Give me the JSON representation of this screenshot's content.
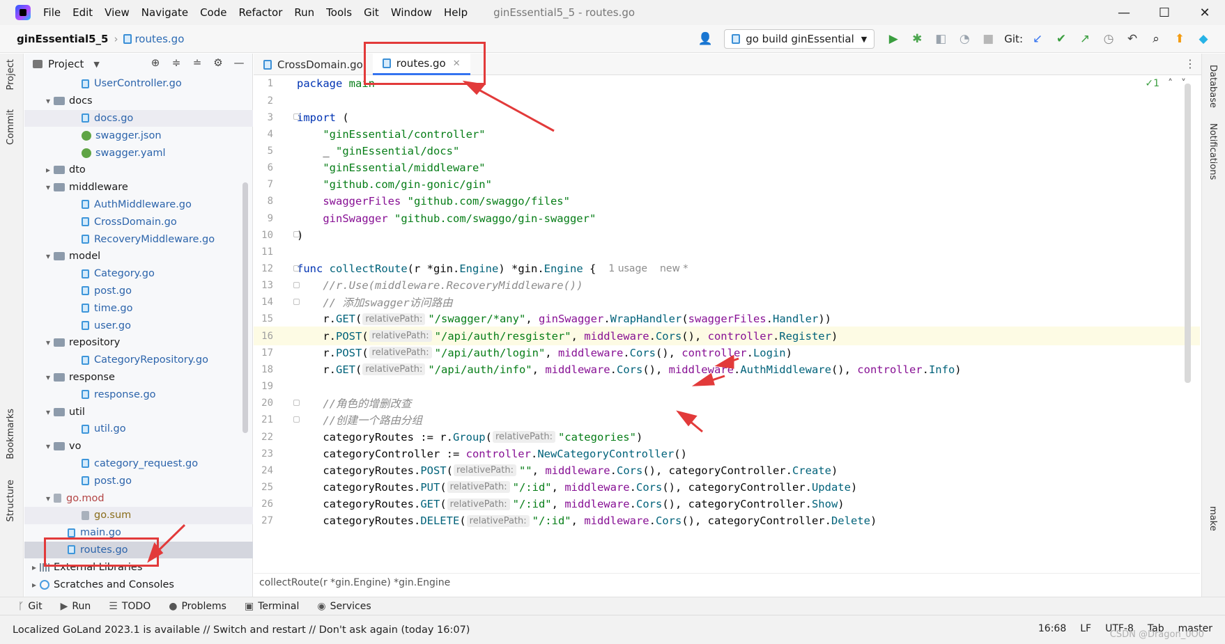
{
  "menu": [
    "File",
    "Edit",
    "View",
    "Navigate",
    "Code",
    "Refactor",
    "Run",
    "Tools",
    "Git",
    "Window",
    "Help"
  ],
  "window_title": "ginEssential5_5 - routes.go",
  "window_controls": [
    "—",
    "☐",
    "✕"
  ],
  "nav": {
    "project_name": "ginEssential5_5",
    "file_name": "routes.go",
    "run_config": "go build ginEssential",
    "git_label": "Git:"
  },
  "left_strip": {
    "project": "Project",
    "commit": "Commit",
    "bookmarks": "Bookmarks",
    "structure": "Structure"
  },
  "right_strip": {
    "database": "Database",
    "notifications": "Notifications",
    "make": "make"
  },
  "project_panel": {
    "title": "Project"
  },
  "tree": [
    {
      "label": "UserController.go",
      "indent": 3,
      "icon": "go",
      "arrow": "",
      "color": "blue"
    },
    {
      "label": "docs",
      "indent": 1,
      "icon": "folder",
      "arrow": "▾",
      "color": ""
    },
    {
      "label": "docs.go",
      "indent": 3,
      "icon": "go",
      "arrow": "",
      "color": "blue",
      "hl": true
    },
    {
      "label": "swagger.json",
      "indent": 3,
      "icon": "json",
      "arrow": "",
      "color": "blue"
    },
    {
      "label": "swagger.yaml",
      "indent": 3,
      "icon": "json",
      "arrow": "",
      "color": "blue"
    },
    {
      "label": "dto",
      "indent": 1,
      "icon": "folder",
      "arrow": "▸",
      "color": ""
    },
    {
      "label": "middleware",
      "indent": 1,
      "icon": "folder",
      "arrow": "▾",
      "color": ""
    },
    {
      "label": "AuthMiddleware.go",
      "indent": 3,
      "icon": "go",
      "arrow": "",
      "color": "blue"
    },
    {
      "label": "CrossDomain.go",
      "indent": 3,
      "icon": "go",
      "arrow": "",
      "color": "blue"
    },
    {
      "label": "RecoveryMiddleware.go",
      "indent": 3,
      "icon": "go",
      "arrow": "",
      "color": "blue"
    },
    {
      "label": "model",
      "indent": 1,
      "icon": "folder",
      "arrow": "▾",
      "color": ""
    },
    {
      "label": "Category.go",
      "indent": 3,
      "icon": "go",
      "arrow": "",
      "color": "blue"
    },
    {
      "label": "post.go",
      "indent": 3,
      "icon": "go",
      "arrow": "",
      "color": "blue"
    },
    {
      "label": "time.go",
      "indent": 3,
      "icon": "go",
      "arrow": "",
      "color": "blue"
    },
    {
      "label": "user.go",
      "indent": 3,
      "icon": "go",
      "arrow": "",
      "color": "blue"
    },
    {
      "label": "repository",
      "indent": 1,
      "icon": "folder",
      "arrow": "▾",
      "color": ""
    },
    {
      "label": "CategoryRepository.go",
      "indent": 3,
      "icon": "go",
      "arrow": "",
      "color": "blue"
    },
    {
      "label": "response",
      "indent": 1,
      "icon": "folder",
      "arrow": "▾",
      "color": ""
    },
    {
      "label": "response.go",
      "indent": 3,
      "icon": "go",
      "arrow": "",
      "color": "blue"
    },
    {
      "label": "util",
      "indent": 1,
      "icon": "folder",
      "arrow": "▾",
      "color": ""
    },
    {
      "label": "util.go",
      "indent": 3,
      "icon": "go",
      "arrow": "",
      "color": "blue"
    },
    {
      "label": "vo",
      "indent": 1,
      "icon": "folder",
      "arrow": "▾",
      "color": ""
    },
    {
      "label": "category_request.go",
      "indent": 3,
      "icon": "go",
      "arrow": "",
      "color": "blue"
    },
    {
      "label": "post.go",
      "indent": 3,
      "icon": "go",
      "arrow": "",
      "color": "blue"
    },
    {
      "label": "go.mod",
      "indent": 1,
      "icon": "mod",
      "arrow": "▾",
      "color": "red"
    },
    {
      "label": "go.sum",
      "indent": 3,
      "icon": "mod",
      "arrow": "",
      "color": "gold",
      "hl": true
    },
    {
      "label": "main.go",
      "indent": 2,
      "icon": "go",
      "arrow": "",
      "color": "blue"
    },
    {
      "label": "routes.go",
      "indent": 2,
      "icon": "go",
      "arrow": "",
      "color": "blue",
      "sel": true
    },
    {
      "label": "External Libraries",
      "indent": 0,
      "icon": "lib",
      "arrow": "▸",
      "color": ""
    },
    {
      "label": "Scratches and Consoles",
      "indent": 0,
      "icon": "scr",
      "arrow": "▸",
      "color": ""
    }
  ],
  "tabs": [
    {
      "label": "CrossDomain.go",
      "active": false
    },
    {
      "label": "routes.go",
      "active": true
    }
  ],
  "inspection": {
    "count": "✓1",
    "up": "˄",
    "down": "˅"
  },
  "code": [
    {
      "n": "1",
      "t": [
        [
          "kw",
          "package"
        ],
        [
          "code",
          " "
        ],
        [
          "str",
          "main"
        ]
      ]
    },
    {
      "n": "2",
      "t": []
    },
    {
      "n": "3",
      "t": [
        [
          "kw",
          "import"
        ],
        [
          "code",
          " ("
        ]
      ]
    },
    {
      "n": "4",
      "t": [
        [
          "code",
          "    "
        ],
        [
          "str",
          "\"ginEssential/controller\""
        ]
      ]
    },
    {
      "n": "5",
      "t": [
        [
          "code",
          "    _ "
        ],
        [
          "str",
          "\"ginEssential/docs\""
        ]
      ]
    },
    {
      "n": "6",
      "t": [
        [
          "code",
          "    "
        ],
        [
          "str",
          "\"ginEssential/middleware\""
        ]
      ]
    },
    {
      "n": "7",
      "t": [
        [
          "code",
          "    "
        ],
        [
          "str",
          "\"github.com/gin-gonic/gin\""
        ]
      ]
    },
    {
      "n": "8",
      "t": [
        [
          "code",
          "    "
        ],
        [
          "gold",
          "swaggerFiles"
        ],
        [
          "code",
          " "
        ],
        [
          "str",
          "\"github.com/swaggo/files\""
        ]
      ]
    },
    {
      "n": "9",
      "t": [
        [
          "code",
          "    "
        ],
        [
          "gold",
          "ginSwagger"
        ],
        [
          "code",
          " "
        ],
        [
          "str",
          "\"github.com/swaggo/gin-swagger\""
        ]
      ]
    },
    {
      "n": "10",
      "t": [
        [
          "code",
          ")"
        ]
      ]
    },
    {
      "n": "11",
      "t": []
    },
    {
      "n": "12",
      "t": [
        [
          "kw",
          "func"
        ],
        [
          "code",
          " "
        ],
        [
          "fn",
          "collectRoute"
        ],
        [
          "code",
          "(r *"
        ],
        [
          "code",
          "gin"
        ],
        [
          "code",
          "."
        ],
        [
          "fn",
          "Engine"
        ],
        [
          "code",
          ") *"
        ],
        [
          "code",
          "gin"
        ],
        [
          "code",
          "."
        ],
        [
          "fn",
          "Engine"
        ],
        [
          "code",
          " {"
        ],
        [
          "hint",
          "1 usage"
        ],
        [
          "hint2",
          "new *"
        ]
      ]
    },
    {
      "n": "13",
      "t": [
        [
          "code",
          "    "
        ],
        [
          "cm",
          "//r.Use(middleware.RecoveryMiddleware())"
        ]
      ]
    },
    {
      "n": "14",
      "t": [
        [
          "code",
          "    "
        ],
        [
          "cm",
          "// 添加swagger访问路由"
        ]
      ]
    },
    {
      "n": "15",
      "t": [
        [
          "code",
          "    r."
        ],
        [
          "fn",
          "GET"
        ],
        [
          "code",
          "("
        ],
        [
          "inlay",
          "relativePath:"
        ],
        [
          "str",
          "\"/swagger/*any\""
        ],
        [
          "code",
          ", "
        ],
        [
          "gold",
          "ginSwagger"
        ],
        [
          "code",
          "."
        ],
        [
          "fn",
          "WrapHandler"
        ],
        [
          "code",
          "("
        ],
        [
          "gold",
          "swaggerFiles"
        ],
        [
          "code",
          "."
        ],
        [
          "fn",
          "Handler"
        ],
        [
          "code",
          "))"
        ]
      ]
    },
    {
      "n": "16",
      "t": [
        [
          "code",
          "    r."
        ],
        [
          "fn",
          "POST"
        ],
        [
          "code",
          "("
        ],
        [
          "inlay",
          "relativePath:"
        ],
        [
          "str",
          "\"/api/auth/resgister\""
        ],
        [
          "code",
          ", "
        ],
        [
          "gold",
          "middleware"
        ],
        [
          "code",
          "."
        ],
        [
          "fn",
          "Cors"
        ],
        [
          "code",
          "(), "
        ],
        [
          "gold",
          "controller"
        ],
        [
          "code",
          "."
        ],
        [
          "fn",
          "Register"
        ],
        [
          "code",
          ")"
        ]
      ],
      "cur": true
    },
    {
      "n": "17",
      "t": [
        [
          "code",
          "    r."
        ],
        [
          "fn",
          "POST"
        ],
        [
          "code",
          "("
        ],
        [
          "inlay",
          "relativePath:"
        ],
        [
          "str",
          "\"/api/auth/login\""
        ],
        [
          "code",
          ", "
        ],
        [
          "gold",
          "middleware"
        ],
        [
          "code",
          "."
        ],
        [
          "fn",
          "Cors"
        ],
        [
          "code",
          "(), "
        ],
        [
          "gold",
          "controller"
        ],
        [
          "code",
          "."
        ],
        [
          "fn",
          "Login"
        ],
        [
          "code",
          ")"
        ]
      ]
    },
    {
      "n": "18",
      "t": [
        [
          "code",
          "    r."
        ],
        [
          "fn",
          "GET"
        ],
        [
          "code",
          "("
        ],
        [
          "inlay",
          "relativePath:"
        ],
        [
          "str",
          "\"/api/auth/info\""
        ],
        [
          "code",
          ", "
        ],
        [
          "gold",
          "middleware"
        ],
        [
          "code",
          "."
        ],
        [
          "fn",
          "Cors"
        ],
        [
          "code",
          "(), "
        ],
        [
          "gold",
          "middleware"
        ],
        [
          "code",
          "."
        ],
        [
          "fn",
          "AuthMiddleware"
        ],
        [
          "code",
          "(), "
        ],
        [
          "gold",
          "controller"
        ],
        [
          "code",
          "."
        ],
        [
          "fn",
          "Info"
        ],
        [
          "code",
          ")"
        ]
      ]
    },
    {
      "n": "19",
      "t": []
    },
    {
      "n": "20",
      "t": [
        [
          "code",
          "    "
        ],
        [
          "cm",
          "//角色的增删改查"
        ]
      ]
    },
    {
      "n": "21",
      "t": [
        [
          "code",
          "    "
        ],
        [
          "cm",
          "//创建一个路由分组"
        ]
      ]
    },
    {
      "n": "22",
      "t": [
        [
          "code",
          "    categoryRoutes := r."
        ],
        [
          "fn",
          "Group"
        ],
        [
          "code",
          "("
        ],
        [
          "inlay",
          "relativePath:"
        ],
        [
          "str",
          "\"categories\""
        ],
        [
          "code",
          ")"
        ]
      ]
    },
    {
      "n": "23",
      "t": [
        [
          "code",
          "    categoryController := "
        ],
        [
          "gold",
          "controller"
        ],
        [
          "code",
          "."
        ],
        [
          "fn",
          "NewCategoryController"
        ],
        [
          "code",
          "()"
        ]
      ]
    },
    {
      "n": "24",
      "t": [
        [
          "code",
          "    categoryRoutes."
        ],
        [
          "fn",
          "POST"
        ],
        [
          "code",
          "("
        ],
        [
          "inlay",
          "relativePath:"
        ],
        [
          "str",
          "\"\""
        ],
        [
          "code",
          ", "
        ],
        [
          "gold",
          "middleware"
        ],
        [
          "code",
          "."
        ],
        [
          "fn",
          "Cors"
        ],
        [
          "code",
          "(), categoryController."
        ],
        [
          "fn",
          "Create"
        ],
        [
          "code",
          ")"
        ]
      ]
    },
    {
      "n": "25",
      "t": [
        [
          "code",
          "    categoryRoutes."
        ],
        [
          "fn",
          "PUT"
        ],
        [
          "code",
          "("
        ],
        [
          "inlay",
          "relativePath:"
        ],
        [
          "str",
          "\"/:id\""
        ],
        [
          "code",
          ", "
        ],
        [
          "gold",
          "middleware"
        ],
        [
          "code",
          "."
        ],
        [
          "fn",
          "Cors"
        ],
        [
          "code",
          "(), categoryController."
        ],
        [
          "fn",
          "Update"
        ],
        [
          "code",
          ")"
        ]
      ]
    },
    {
      "n": "26",
      "t": [
        [
          "code",
          "    categoryRoutes."
        ],
        [
          "fn",
          "GET"
        ],
        [
          "code",
          "("
        ],
        [
          "inlay",
          "relativePath:"
        ],
        [
          "str",
          "\"/:id\""
        ],
        [
          "code",
          ", "
        ],
        [
          "gold",
          "middleware"
        ],
        [
          "code",
          "."
        ],
        [
          "fn",
          "Cors"
        ],
        [
          "code",
          "(), categoryController."
        ],
        [
          "fn",
          "Show"
        ],
        [
          "code",
          ")"
        ]
      ]
    },
    {
      "n": "27",
      "t": [
        [
          "code",
          "    categoryRoutes."
        ],
        [
          "fn",
          "DELETE"
        ],
        [
          "code",
          "("
        ],
        [
          "inlay",
          "relativePath:"
        ],
        [
          "str",
          "\"/:id\""
        ],
        [
          "code",
          ", "
        ],
        [
          "gold",
          "middleware"
        ],
        [
          "code",
          "."
        ],
        [
          "fn",
          "Cors"
        ],
        [
          "code",
          "(), categoryController."
        ],
        [
          "fn",
          "Delete"
        ],
        [
          "code",
          ")"
        ]
      ]
    }
  ],
  "editor_breadcrumb": "collectRoute(r *gin.Engine) *gin.Engine",
  "tool_windows": [
    {
      "icon": "ᚴ",
      "label": "Git"
    },
    {
      "icon": "▶",
      "label": "Run"
    },
    {
      "icon": "☰",
      "label": "TODO"
    },
    {
      "icon": "●",
      "label": "Problems"
    },
    {
      "icon": "▣",
      "label": "Terminal"
    },
    {
      "icon": "◉",
      "label": "Services"
    }
  ],
  "status": {
    "message": "Localized GoLand 2023.1 is available // Switch and restart // Don't ask again (today 16:07)",
    "position": "16:68",
    "line_sep": "LF",
    "encoding": "UTF-8",
    "indent": "Tab",
    "branch": "master"
  },
  "watermark": "CSDN @Dragon_0O0",
  "colors": {
    "annotation": "#e23a3a",
    "accent": "#3574f0"
  }
}
